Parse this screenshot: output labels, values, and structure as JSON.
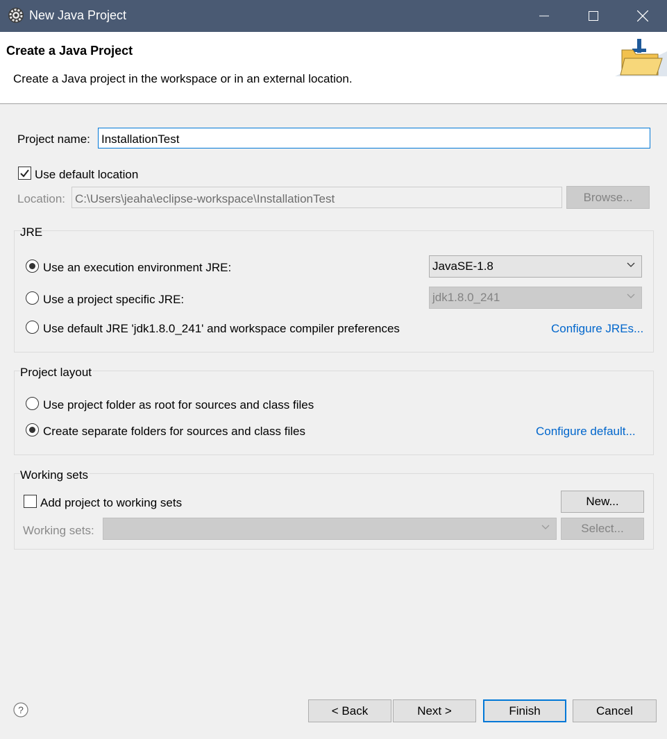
{
  "window": {
    "title": "New Java Project",
    "controls": [
      "minimize-icon",
      "maximize-icon",
      "close-icon"
    ]
  },
  "header": {
    "title": "Create a Java Project",
    "description": "Create a Java project in the workspace or in an external location."
  },
  "project_name": {
    "label": "Project name:",
    "value": "InstallationTest"
  },
  "location": {
    "use_default_label": "Use default location",
    "use_default_checked": true,
    "label": "Location:",
    "value": "C:\\Users\\jeaha\\eclipse-workspace\\InstallationTest",
    "browse_label": "Browse..."
  },
  "jre": {
    "group_label": "JRE",
    "option1_label": "Use an execution environment JRE:",
    "option1_value": "JavaSE-1.8",
    "option2_label": "Use a project specific JRE:",
    "option2_value": "jdk1.8.0_241",
    "option3_label": "Use default JRE 'jdk1.8.0_241' and workspace compiler preferences",
    "configure_link": "Configure JREs...",
    "selected": 1
  },
  "layout": {
    "group_label": "Project layout",
    "option1_label": "Use project folder as root for sources and class files",
    "option2_label": "Create separate folders for sources and class files",
    "configure_link": "Configure default...",
    "selected": 2
  },
  "working_sets": {
    "group_label": "Working sets",
    "add_label": "Add project to working sets",
    "add_checked": false,
    "new_label": "New...",
    "label": "Working sets:",
    "value": "",
    "select_label": "Select..."
  },
  "footer": {
    "help_icon": "help-icon",
    "back_label": "< Back",
    "next_label": "Next >",
    "finish_label": "Finish",
    "cancel_label": "Cancel"
  },
  "colors": {
    "titlebar": "#4a5a73",
    "link": "#0066cc",
    "focus_border": "#0078d7"
  }
}
